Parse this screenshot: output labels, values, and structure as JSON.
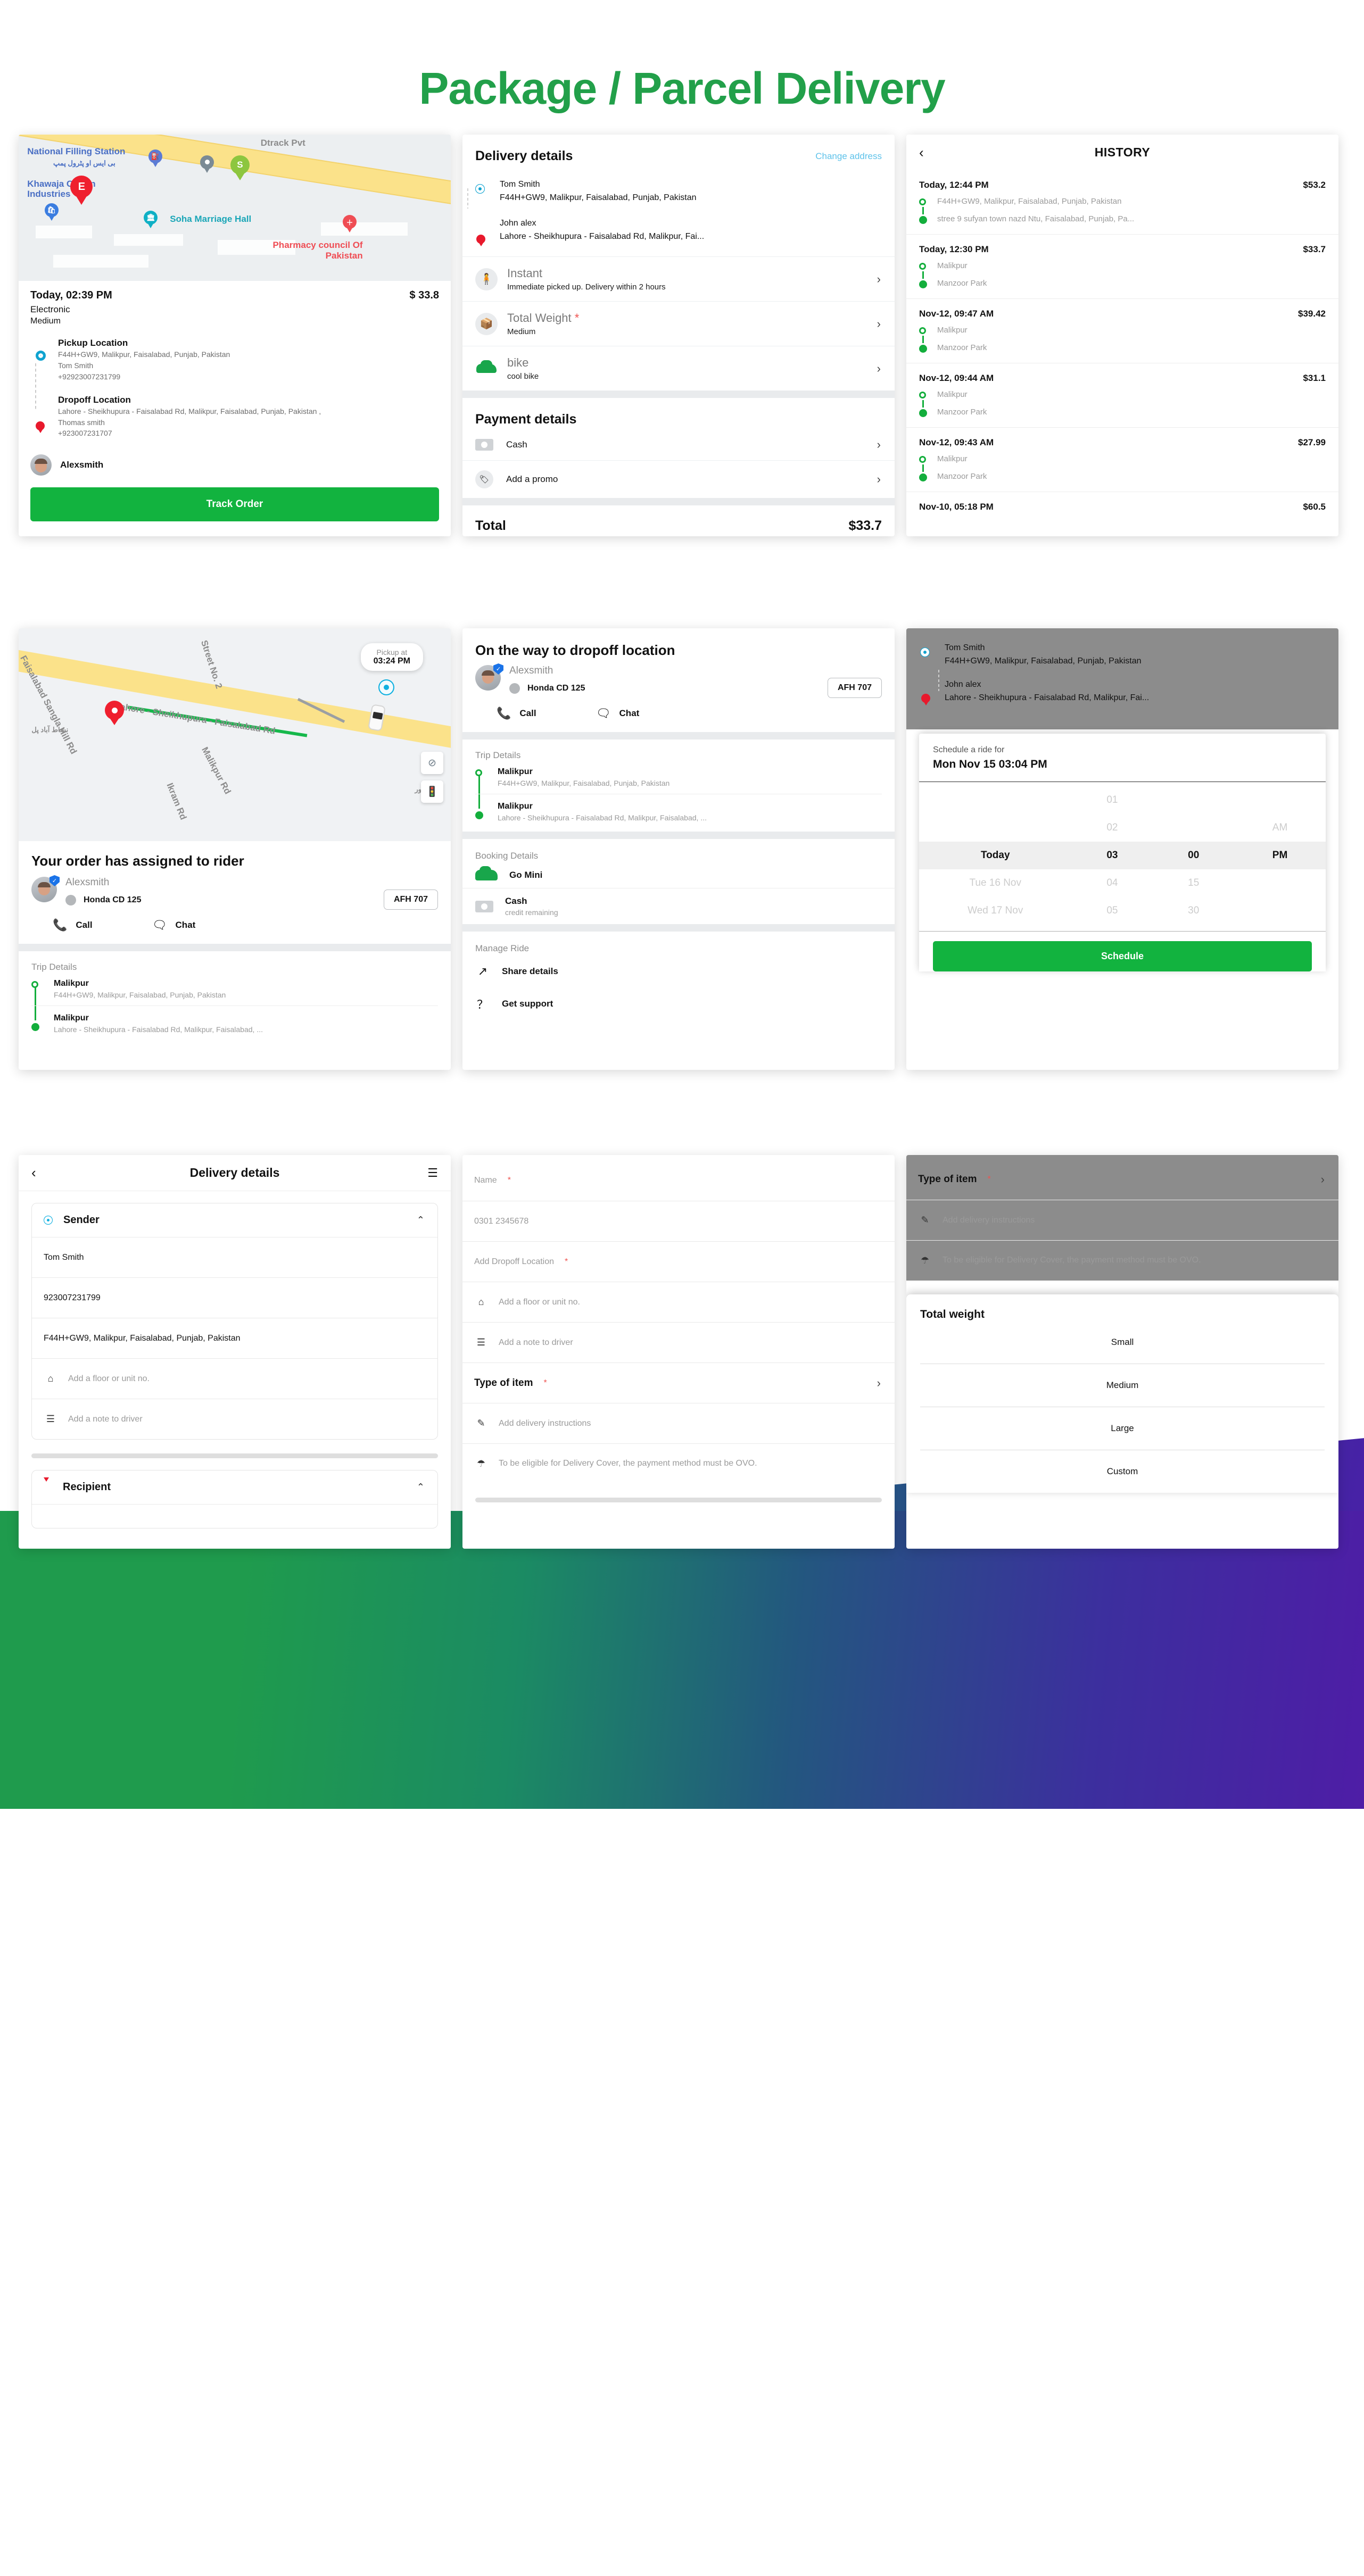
{
  "page": {
    "title": "Package / Parcel Delivery",
    "accent": "#22A04A",
    "primary": "#12B33F"
  },
  "card_order": {
    "map_labels": {
      "national_filling": "National Filling Station",
      "national_filling_urdu": "بی ایس او پٹرول پمپ",
      "khawaja_cotton": "Khawaja Cotton Industries",
      "soha": "Soha Marriage Hall",
      "pharmacy": "Pharmacy council Of Pakistan",
      "dtrack": "Dtrack Pvt",
      "marker_e": "E",
      "marker_s": "S"
    },
    "time": "Today, 02:39 PM",
    "price": "$ 33.8",
    "item_type": "Electronic",
    "weight": "Medium",
    "pickup": {
      "title": "Pickup Location",
      "address": "F44H+GW9, Malikpur, Faisalabad, Punjab, Pakistan",
      "name": "Tom Smith",
      "phone": "+92923007231799"
    },
    "dropoff": {
      "title": "Dropoff Location",
      "address": "Lahore - Sheikhupura - Faisalabad Rd, Malikpur, Faisalabad, Punjab, Pakistan ,",
      "name": "Thomas smith",
      "phone": "+923007231707"
    },
    "rider_name": "Alexsmith",
    "track_button": "Track Order"
  },
  "card_delivery_details": {
    "title": "Delivery details",
    "change_address": "Change address",
    "sender": {
      "name": "Tom Smith",
      "address": "F44H+GW9, Malikpur, Faisalabad, Punjab, Pakistan"
    },
    "recipient": {
      "name": "John alex",
      "address": "Lahore - Sheikhupura - Faisalabad Rd, Malikpur, Fai..."
    },
    "options": [
      {
        "label": "Instant",
        "sub": "Immediate picked up. Delivery within 2 hours",
        "required": false,
        "icon": "courier-icon"
      },
      {
        "label": "Total Weight",
        "sub": "Medium",
        "required": true,
        "icon": "box-icon"
      },
      {
        "label": "bike",
        "sub": "cool bike",
        "required": false,
        "icon": "vehicle-icon"
      }
    ],
    "payment_title": "Payment details",
    "payment_rows": [
      {
        "label": "Cash",
        "icon": "cash-icon"
      },
      {
        "label": "Add a promo",
        "icon": "promo-icon"
      }
    ],
    "total_label": "Total",
    "total_value": "$33.7"
  },
  "card_history": {
    "title": "HISTORY",
    "back_icon": "back-chevron-icon",
    "items": [
      {
        "date": "Today, 12:44 PM",
        "amount": "$53.2",
        "from": "F44H+GW9, Malikpur, Faisalabad, Punjab, Pakistan",
        "to": "stree 9 sufyan town nazd Ntu, Faisalabad, Punjab, Pa..."
      },
      {
        "date": "Today, 12:30 PM",
        "amount": "$33.7",
        "from": "Malikpur",
        "to": "Manzoor Park"
      },
      {
        "date": "Nov-12, 09:47 AM",
        "amount": "$39.42",
        "from": "Malikpur",
        "to": "Manzoor Park"
      },
      {
        "date": "Nov-12, 09:44 AM",
        "amount": "$31.1",
        "from": "Malikpur",
        "to": "Manzoor Park"
      },
      {
        "date": "Nov-12, 09:43 AM",
        "amount": "$27.99",
        "from": "Malikpur",
        "to": "Manzoor Park"
      },
      {
        "date": "Nov-10, 05:18 PM",
        "amount": "$60.5",
        "from": "",
        "to": ""
      }
    ]
  },
  "card_assigned": {
    "map": {
      "pickup_label": "Pickup at",
      "pickup_time": "03:24 PM",
      "road_label": "Lahore - Sheikhupura - Faisalabad Rd",
      "street_label": "Street No. 2",
      "left_road_label": "Faisalabad Sangla Hill Rd",
      "malikpur_rd": "Malikpur Rd",
      "ikram_rd": "Ikram Rd",
      "urdu_bridge": "نشاط آباد پل",
      "urdu_right": "ملک پور"
    },
    "title": "Your order has assigned to rider",
    "driver_name": "Alexsmith",
    "vehicle": "Honda CD 125",
    "plate": "AFH 707",
    "call_label": "Call",
    "chat_label": "Chat",
    "trip_title": "Trip Details",
    "trip_stops": [
      {
        "name": "Malikpur",
        "address": "F44H+GW9, Malikpur, Faisalabad, Punjab, Pakistan"
      },
      {
        "name": "Malikpur",
        "address": "Lahore - Sheikhupura - Faisalabad Rd, Malikpur, Faisalabad, ..."
      }
    ]
  },
  "card_onway": {
    "title": "On the way to dropoff location",
    "driver_name": "Alexsmith",
    "vehicle": "Honda CD 125",
    "plate": "AFH 707",
    "call_label": "Call",
    "chat_label": "Chat",
    "trip_title": "Trip Details",
    "trip_stops": [
      {
        "name": "Malikpur",
        "address": "F44H+GW9, Malikpur, Faisalabad, Punjab, Pakistan"
      },
      {
        "name": "Malikpur",
        "address": "Lahore - Sheikhupura - Faisalabad Rd, Malikpur, Faisalabad, ..."
      }
    ],
    "booking_title": "Booking Details",
    "booking_vehicle": "Go Mini",
    "booking_payment": "Cash",
    "booking_payment_sub": "credit remaining",
    "manage_title": "Manage Ride",
    "manage_items": [
      {
        "label": "Share details",
        "icon": "share-icon"
      },
      {
        "label": "Get support",
        "icon": "help-icon"
      }
    ]
  },
  "card_schedule": {
    "sender": {
      "name": "Tom Smith",
      "address": "F44H+GW9, Malikpur, Faisalabad, Punjab, Pakistan"
    },
    "recipient": {
      "name": "John alex",
      "address": "Lahore - Sheikhupura - Faisalabad Rd, Malikpur, Fai..."
    },
    "sheet_label": "Schedule a ride for",
    "sheet_value": "Mon Nov 15 03:04 PM",
    "wheel": [
      {
        "day": "",
        "hour": "01",
        "minute": "",
        "meridiem": "",
        "selected": false
      },
      {
        "day": "",
        "hour": "02",
        "minute": "",
        "meridiem": "AM",
        "selected": false
      },
      {
        "day": "Today",
        "hour": "03",
        "minute": "00",
        "meridiem": "PM",
        "selected": true
      },
      {
        "day": "Tue 16 Nov",
        "hour": "04",
        "minute": "15",
        "meridiem": "",
        "selected": false
      },
      {
        "day": "Wed 17 Nov",
        "hour": "05",
        "minute": "30",
        "meridiem": "",
        "selected": false
      }
    ],
    "button": "Schedule"
  },
  "card_sender_form": {
    "app_title": "Delivery details",
    "back_icon": "back-chevron-icon",
    "menu_icon": "hamburger-icon",
    "sender_panel": {
      "title": "Sender",
      "caret": "chevron-up-icon"
    },
    "fields": [
      {
        "value": "Tom Smith",
        "placeholder": "",
        "icon": ""
      },
      {
        "value": "923007231799",
        "placeholder": "",
        "icon": ""
      },
      {
        "value": "F44H+GW9, Malikpur, Faisalabad, Punjab, Pakistan",
        "placeholder": "",
        "icon": ""
      },
      {
        "value": "",
        "placeholder": "Add a floor or unit no.",
        "icon": "home-info-icon"
      },
      {
        "value": "",
        "placeholder": "Add a note to driver",
        "icon": "note-icon"
      }
    ],
    "recipient_panel": {
      "title": "Recipient",
      "caret": "chevron-up-icon"
    }
  },
  "card_recipient_form": {
    "fields": [
      {
        "value": "",
        "placeholder": "Name",
        "required": true,
        "icon": ""
      },
      {
        "value": "",
        "placeholder": "0301 2345678",
        "required": false,
        "icon": ""
      },
      {
        "value": "",
        "placeholder": "Add Dropoff Location",
        "required": true,
        "icon": ""
      },
      {
        "value": "",
        "placeholder": "Add a floor or unit no.",
        "required": false,
        "icon": "home-info-icon"
      },
      {
        "value": "",
        "placeholder": "Add a note to driver",
        "required": false,
        "icon": "note-icon"
      }
    ],
    "type_of_item": {
      "label": "Type of item",
      "required": true,
      "chevron": "chevron-right-icon"
    },
    "instructions": {
      "placeholder": "Add delivery instructions",
      "icon": "pencil-icon"
    },
    "cover_note": {
      "text": "To be eligible for Delivery Cover, the payment method must be OVO.",
      "icon": "umbrella-icon"
    }
  },
  "card_total_weight": {
    "type_of_item": {
      "label": "Type of item",
      "required": true,
      "chevron": "chevron-right-icon"
    },
    "instructions": {
      "placeholder": "Add delivery instructions",
      "icon": "pencil-icon"
    },
    "cover_note": {
      "text": "To be eligible for Delivery Cover, the payment method must be OVO.",
      "icon": "umbrella-icon"
    },
    "sheet_title": "Total weight",
    "options": [
      "Small",
      "Medium",
      "Large",
      "Custom"
    ]
  }
}
